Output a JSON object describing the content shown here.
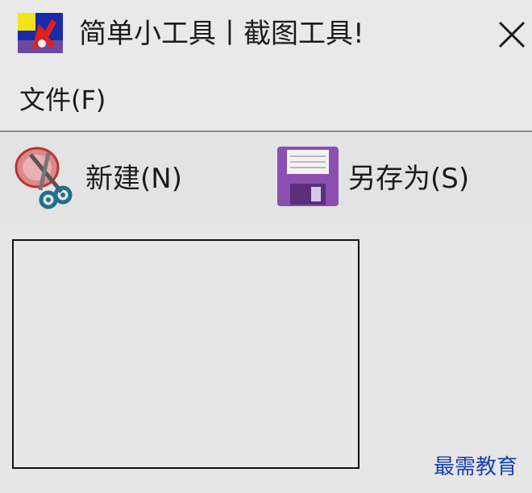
{
  "window": {
    "title": "简单小工具丨截图工具!",
    "close_icon": "close-icon",
    "app_icon": "app-logo-icon"
  },
  "menubar": {
    "items": [
      {
        "label": "文件(F)"
      }
    ]
  },
  "toolbar": {
    "new_label": "新建(N)",
    "new_icon": "scissors-icon",
    "save_label": "另存为(S)",
    "save_icon": "floppy-disk-icon"
  },
  "canvas": {
    "background": "#e7e7e7",
    "border": "#111111"
  },
  "watermark": {
    "text": "最需教育",
    "color": "#1a3fb0"
  }
}
